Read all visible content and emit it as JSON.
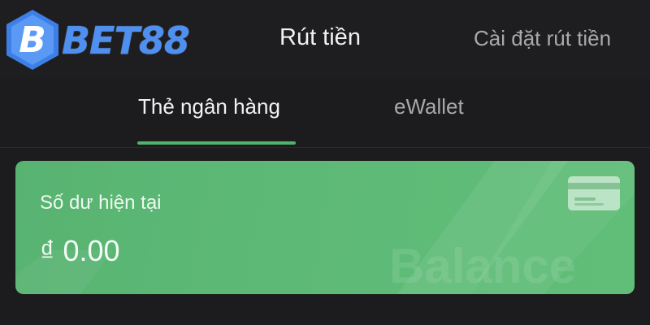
{
  "app": {
    "logo_text": "BET88",
    "page_title": "Rút tiền",
    "settings_link": "Cài đặt rút tiền"
  },
  "tabs": [
    {
      "label": "Thẻ ngân hàng",
      "active": true
    },
    {
      "label": "eWallet",
      "active": false
    }
  ],
  "balance_card": {
    "label": "Số dư hiện tại",
    "amount": "₫ 0.00",
    "watermark": "Balance",
    "icon": "credit-card-icon"
  },
  "colors": {
    "accent_green": "#4fb36c",
    "card_green": "#5db975",
    "logo_blue": "#4e8ff0",
    "background": "#1c1c1e"
  }
}
